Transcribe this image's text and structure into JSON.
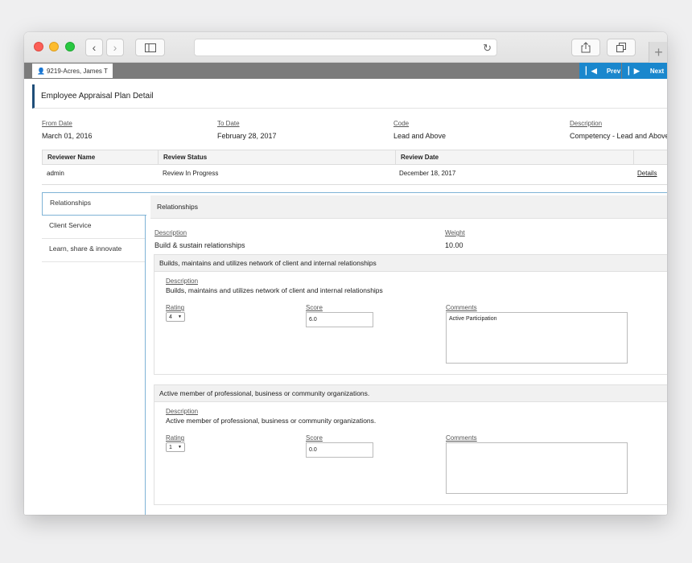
{
  "app_bar": {
    "employee": "9219-Acres, James T",
    "prev_label": "Prev",
    "next_label": "Next"
  },
  "page_title": "Employee Appraisal Plan Detail",
  "plan": {
    "from_date_label": "From Date",
    "from_date": "March 01, 2016",
    "to_date_label": "To Date",
    "to_date": "February 28, 2017",
    "code_label": "Code",
    "code": "Lead and Above",
    "description_label": "Description",
    "description": "Competency - Lead and Above"
  },
  "reviewers": {
    "headers": [
      "Reviewer Name",
      "Review Status",
      "Review Date"
    ],
    "rows": [
      {
        "name": "admin",
        "status": "Review In Progress",
        "date": "December 18, 2017",
        "action": "Details"
      }
    ]
  },
  "tabs": [
    {
      "label": "Relationships",
      "active": true
    },
    {
      "label": "Client Service",
      "active": false
    },
    {
      "label": "Learn, share & innovate",
      "active": false
    }
  ],
  "section": {
    "title": "Relationships",
    "description_label": "Description",
    "description": "Build & sustain relationships",
    "weight_label": "Weight",
    "weight": "10.00"
  },
  "competencies": [
    {
      "title": "Builds, maintains and utilizes network of client and internal relationships",
      "description_label": "Description",
      "description": "Builds, maintains and utilizes network of client and internal relationships",
      "rating_label": "Rating",
      "rating": "4",
      "score_label": "Score",
      "score": "6.0",
      "comments_label": "Comments",
      "comments": "Active Participation"
    },
    {
      "title": "Active member of professional, business or community organizations.",
      "description_label": "Description",
      "description": "Active member of professional, business or community organizations.",
      "rating_label": "Rating",
      "rating": "1",
      "score_label": "Score",
      "score": "0.0",
      "comments_label": "Comments",
      "comments": ""
    }
  ],
  "colors": {
    "accent": "#1a87cd",
    "title_bar": "#1f4e79",
    "app_bar": "#7b7b7b"
  }
}
